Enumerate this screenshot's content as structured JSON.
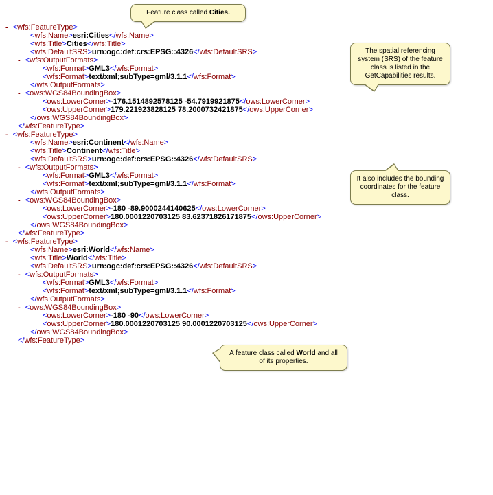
{
  "callouts": {
    "c1_prefix": "Feature class called ",
    "c1_bold": "Cities.",
    "c2": "The spatial referencing system (SRS) of the feature class is listed in the GetCapabilities results.",
    "c3": "It also includes the bounding coordinates for the feature class.",
    "c4_prefix": "A feature class called ",
    "c4_bold": "World",
    "c4_suffix": " and all of its properties."
  },
  "tags": {
    "featuretype_open": "<wfs:FeatureType>",
    "featuretype_close": "</wfs:FeatureType>",
    "name_open": "<wfs:Name>",
    "name_close": "</wfs:Name>",
    "title_open": "<wfs:Title>",
    "title_close": "</wfs:Title>",
    "srs_open": "<wfs:DefaultSRS>",
    "srs_close": "</wfs:DefaultSRS>",
    "outputformats_open": "<wfs:OutputFormats>",
    "outputformats_close": "</wfs:OutputFormats>",
    "format_open": "<wfs:Format>",
    "format_close": "</wfs:Format>",
    "bbox_open": "<ows:WGS84BoundingBox>",
    "bbox_close": "</ows:WGS84BoundingBox>",
    "lower_open": "<ows:LowerCorner>",
    "lower_close": "</ows:LowerCorner>",
    "upper_open": "<ows:UpperCorner>",
    "upper_close": "</ows:UpperCorner>"
  },
  "ft": [
    {
      "name": "esri:Cities",
      "title": "Cities",
      "srs": "urn:ogc:def:crs:EPSG::4326",
      "formats": [
        "GML3",
        "text/xml;subType=gml/3.1.1"
      ],
      "lower": "-176.1514892578125 -54.7919921875",
      "upper": "179.221923828125 78.2000732421875"
    },
    {
      "name": "esri:Continent",
      "title": "Continent",
      "srs": "urn:ogc:def:crs:EPSG::4326",
      "formats": [
        "GML3",
        "text/xml;subType=gml/3.1.1"
      ],
      "lower": "-180 -89.9000244140625",
      "upper": "180.0001220703125 83.62371826171875"
    },
    {
      "name": "esri:World",
      "title": "World",
      "srs": "urn:ogc:def:crs:EPSG::4326",
      "formats": [
        "GML3",
        "text/xml;subType=gml/3.1.1"
      ],
      "lower": "-180 -90",
      "upper": "180.0001220703125 90.0001220703125"
    }
  ]
}
